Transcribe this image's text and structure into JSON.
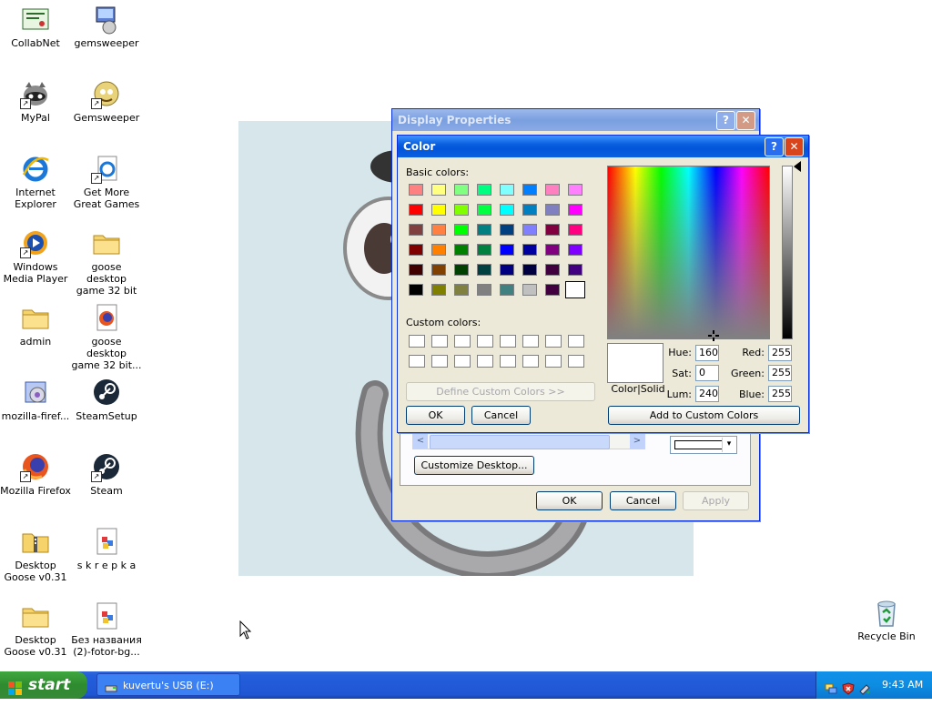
{
  "desktop": {
    "icons": [
      {
        "label": "CollabNet",
        "icon": "certificate-icon",
        "shortcut": false
      },
      {
        "label": "gemsweeper",
        "icon": "installer-icon",
        "shortcut": false
      },
      {
        "label": "MyPal",
        "icon": "raccoon-icon",
        "shortcut": true
      },
      {
        "label": "Gemsweeper",
        "icon": "gem-character-icon",
        "shortcut": true
      },
      {
        "label": "Internet Explorer",
        "icon": "ie-icon",
        "shortcut": false
      },
      {
        "label": "Get More Great Games",
        "icon": "ie-doc-icon",
        "shortcut": true
      },
      {
        "label": "Windows Media Player",
        "icon": "media-player-icon",
        "shortcut": true
      },
      {
        "label": "goose desktop game 32 bit ...",
        "icon": "folder-icon",
        "shortcut": false
      },
      {
        "label": "admin",
        "icon": "folder-icon",
        "shortcut": false
      },
      {
        "label": "goose desktop game 32 bit...",
        "icon": "firefox-doc-icon",
        "shortcut": false
      },
      {
        "label": "mozilla-firef...",
        "icon": "setup-icon",
        "shortcut": false
      },
      {
        "label": "SteamSetup",
        "icon": "steam-icon",
        "shortcut": false
      },
      {
        "label": "Mozilla Firefox",
        "icon": "firefox-icon",
        "shortcut": true
      },
      {
        "label": "Steam",
        "icon": "steam-icon",
        "shortcut": true
      },
      {
        "label": "Desktop Goose v0.31",
        "icon": "zip-folder-icon",
        "shortcut": false
      },
      {
        "label": "s k r e p k a",
        "icon": "image-file-icon",
        "shortcut": false
      },
      {
        "label": "Desktop Goose v0.31",
        "icon": "folder-icon",
        "shortcut": false
      },
      {
        "label": "Без названия (2)-fotor-bg...",
        "icon": "image-file-icon",
        "shortcut": false
      }
    ],
    "recycle_bin": "Recycle Bin"
  },
  "display_properties": {
    "title": "Display Properties",
    "help": "?",
    "close": "✕",
    "customize_desktop": "Customize Desktop...",
    "ok": "OK",
    "cancel": "Cancel",
    "apply": "Apply",
    "scroll_left": "<",
    "scroll_right": ">",
    "dropdown_arrow": "▾"
  },
  "color_dialog": {
    "title": "Color",
    "help": "?",
    "close": "✕",
    "basic_colors_label": "Basic colors:",
    "custom_colors_label": "Custom colors:",
    "define_custom": "Define Custom Colors >>",
    "ok": "OK",
    "cancel": "Cancel",
    "color_solid_label": "Color|Solid",
    "hue_label": "Hue:",
    "hue": "160",
    "sat_label": "Sat:",
    "sat": "0",
    "lum_label": "Lum:",
    "lum": "240",
    "red_label": "Red:",
    "red": "255",
    "green_label": "Green:",
    "green": "255",
    "blue_label": "Blue:",
    "blue": "255",
    "add_custom": "Add to Custom Colors",
    "basic_colors": [
      "#ff8080",
      "#ffff80",
      "#80ff80",
      "#00ff80",
      "#80ffff",
      "#0080ff",
      "#ff80c0",
      "#ff80ff",
      "#ff0000",
      "#ffff00",
      "#80ff00",
      "#00ff40",
      "#00ffff",
      "#0080c0",
      "#8080c0",
      "#ff00ff",
      "#804040",
      "#ff8040",
      "#00ff00",
      "#008080",
      "#004080",
      "#8080ff",
      "#800040",
      "#ff0080",
      "#800000",
      "#ff8000",
      "#008000",
      "#008040",
      "#0000ff",
      "#0000a0",
      "#800080",
      "#8000ff",
      "#400000",
      "#804000",
      "#004000",
      "#004040",
      "#000080",
      "#000040",
      "#400040",
      "#400080",
      "#000000",
      "#808000",
      "#808040",
      "#808080",
      "#408080",
      "#c0c0c0",
      "#400040",
      "#ffffff"
    ],
    "selected_swatch_index": 47
  },
  "taskbar": {
    "start": "start",
    "task_label": "kuvertu's USB (E:)",
    "clock": "9:43 AM"
  }
}
